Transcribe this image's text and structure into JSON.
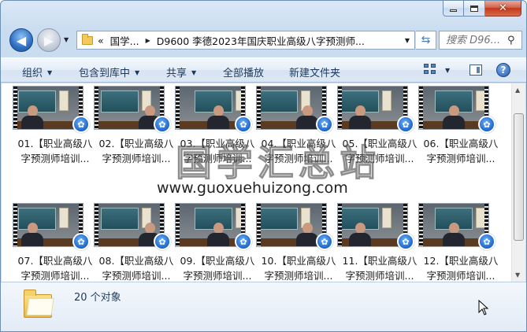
{
  "window": {
    "caption_buttons": [
      "minimize",
      "maximize",
      "close"
    ]
  },
  "nav": {
    "breadcrumb_prefix": "«",
    "breadcrumbs": [
      "国学...",
      "D9600 李德2023年国庆职业高级八字预测师..."
    ],
    "search_placeholder": "搜索 D96..."
  },
  "toolbar": {
    "organize": "组织",
    "include_in_library": "包含到库中",
    "share": "共享",
    "play_all": "全部播放",
    "new_folder": "新建文件夹"
  },
  "files": [
    {
      "line1": "01.【职业高级八",
      "line2": "字预测师培训..."
    },
    {
      "line1": "02.【职业高级八",
      "line2": "字预测师培训..."
    },
    {
      "line1": "03.【职业高级八",
      "line2": "字预测师培训..."
    },
    {
      "line1": "04.【职业高级八",
      "line2": "字预测师培训..."
    },
    {
      "line1": "05.【职业高级八",
      "line2": "字预测师培训..."
    },
    {
      "line1": "06.【职业高级八",
      "line2": "字预测师培训..."
    },
    {
      "line1": "07.【职业高级八",
      "line2": "字预测师培训..."
    },
    {
      "line1": "08.【职业高级八",
      "line2": "字预测师培训..."
    },
    {
      "line1": "09.【职业高级八",
      "line2": "字预测师培训..."
    },
    {
      "line1": "10.【职业高级八",
      "line2": "字预测师培训..."
    },
    {
      "line1": "11.【职业高级八",
      "line2": "字预测师培训..."
    },
    {
      "line1": "12.【职业高级八",
      "line2": "字预测师培训..."
    }
  ],
  "watermark": {
    "title": "国学汇总站",
    "url": "www.guoxuehuizong.com"
  },
  "status": {
    "item_count": "20 个对象"
  }
}
